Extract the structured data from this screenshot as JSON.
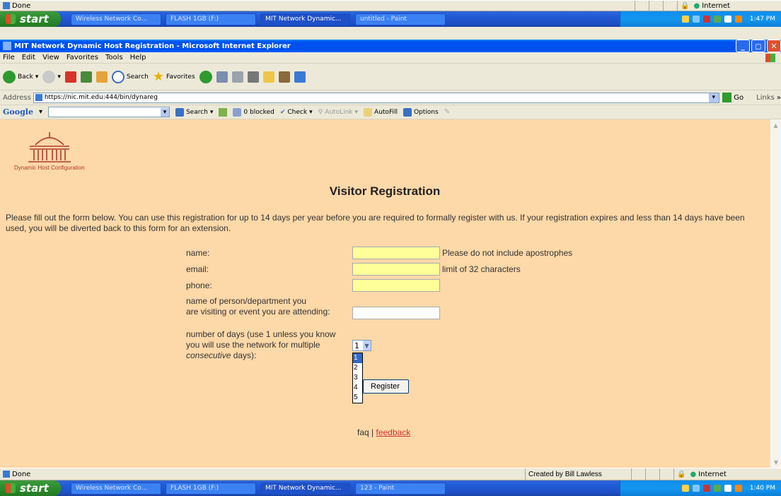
{
  "top_status": {
    "left_text": "Done",
    "zone_text": "Internet"
  },
  "taskbar_top": {
    "start_label": "start",
    "tasks": [
      "Wireless Network Co...",
      "FLASH 1GB (F:)",
      "MIT Network Dynamic...",
      "untitled - Paint"
    ],
    "clock": "1:47 PM"
  },
  "window": {
    "title": "MIT Network Dynamic Host Registration - Microsoft Internet Explorer",
    "menus": [
      "File",
      "Edit",
      "View",
      "Favorites",
      "Tools",
      "Help"
    ],
    "toolbar": {
      "back": "Back",
      "search": "Search",
      "favorites": "Favorites"
    },
    "address": {
      "label": "Address",
      "url": "https://nic.mit.edu:444/bin/dynareg",
      "go": "Go",
      "links": "Links"
    },
    "google_bar": {
      "brand": "Google",
      "search": "Search",
      "blocked": "0 blocked",
      "check": "Check",
      "autolink": "AutoLink",
      "autofill": "AutoFill",
      "options": "Options"
    }
  },
  "page": {
    "logo_caption": "Dynamic Host Configuration",
    "heading": "Visitor Registration",
    "intro": "Please fill out the form below. You can use this registration for up to 14 days per year before you are required to formally register with us. If your registration expires and less than 14 days have been used, you will be diverted back to this form for an extension.",
    "form": {
      "name_label": "name:",
      "name_note": "Please do not include apostrophes",
      "email_label": "email:",
      "email_note": "limit of 32 characters",
      "phone_label": "phone:",
      "visiting_label_1": "name of person/department you",
      "visiting_label_2": "are visiting or event you are attending:",
      "days_label_1": "number of days (use 1 unless you know",
      "days_label_2": "you will use the network for multiple",
      "days_label_3_em": "consecutive",
      "days_label_3_rest": " days):",
      "days_selected": "1",
      "days_options": [
        "1",
        "2",
        "3",
        "4",
        "5"
      ],
      "register_label": "Register"
    },
    "footer_faq": "faq |",
    "footer_feedback": "feedback"
  },
  "ie_status": {
    "left_text": "Done",
    "created_by": "Created by Bill Lawless",
    "zone_text": "Internet"
  },
  "taskbar_bottom": {
    "start_label": "start",
    "tasks": [
      "Wireless Network Co...",
      "FLASH 1GB (F:)",
      "MIT Network Dynamic...",
      "123 - Paint"
    ],
    "clock": "1:40 PM"
  },
  "colors": {
    "page_bg": "#fdd8a8",
    "field_yellow": "#ffff99",
    "link": "#cc3333"
  }
}
